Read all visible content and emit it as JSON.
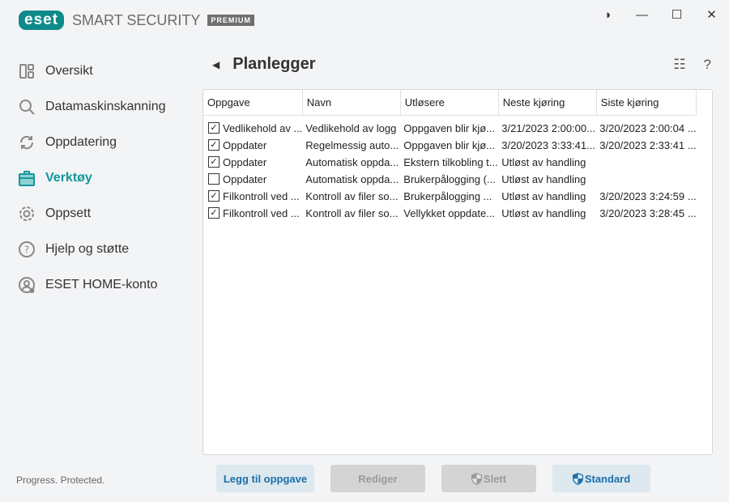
{
  "app": {
    "brand": "eset",
    "product": "SMART SECURITY",
    "edition": "PREMIUM",
    "tagline": "Progress. Protected."
  },
  "window": {
    "theme": "◑",
    "minimize": "—",
    "maximize": "☐",
    "close": "✕"
  },
  "sidebar": {
    "items": [
      {
        "label": "Oversikt",
        "icon": "dashboard-icon"
      },
      {
        "label": "Datamaskinskanning",
        "icon": "search-icon"
      },
      {
        "label": "Oppdatering",
        "icon": "refresh-icon"
      },
      {
        "label": "Verktøy",
        "icon": "toolbox-icon",
        "active": true
      },
      {
        "label": "Oppsett",
        "icon": "gear-icon"
      },
      {
        "label": "Hjelp og støtte",
        "icon": "help-icon"
      },
      {
        "label": "ESET HOME-konto",
        "icon": "account-icon"
      }
    ]
  },
  "header": {
    "title": "Planlegger",
    "back": "◀",
    "view_icon": "☷",
    "help": "?"
  },
  "table": {
    "columns": [
      "Oppgave",
      "Navn",
      "Utløsere",
      "Neste kjøring",
      "Siste kjøring"
    ],
    "rows": [
      {
        "checked": true,
        "cells": [
          "Vedlikehold av ...",
          "Vedlikehold av logg",
          "Oppgaven blir kjø...",
          "3/21/2023 2:00:00...",
          "3/20/2023 2:00:04 ..."
        ]
      },
      {
        "checked": true,
        "cells": [
          "Oppdater",
          "Regelmessig auto...",
          "Oppgaven blir kjø...",
          "3/20/2023 3:33:41...",
          "3/20/2023 2:33:41 ..."
        ]
      },
      {
        "checked": true,
        "cells": [
          "Oppdater",
          "Automatisk oppda...",
          "Ekstern tilkobling t...",
          "Utløst av handling",
          ""
        ]
      },
      {
        "checked": false,
        "cells": [
          "Oppdater",
          "Automatisk oppda...",
          "Brukerpålogging (...",
          "Utløst av handling",
          ""
        ]
      },
      {
        "checked": true,
        "cells": [
          "Filkontroll ved ...",
          "Kontroll av filer so...",
          "Brukerpålogging ...",
          "Utløst av handling",
          "3/20/2023 3:24:59 ..."
        ]
      },
      {
        "checked": true,
        "cells": [
          "Filkontroll ved ...",
          "Kontroll av filer so...",
          "Vellykket oppdate...",
          "Utløst av handling",
          "3/20/2023 3:28:45 ..."
        ]
      }
    ]
  },
  "buttons": {
    "add": "Legg til oppgave",
    "edit": "Rediger",
    "delete": "Slett",
    "default": "Standard"
  },
  "colors": {
    "accent": "#13979b",
    "button_text": "#1b6fa8"
  }
}
